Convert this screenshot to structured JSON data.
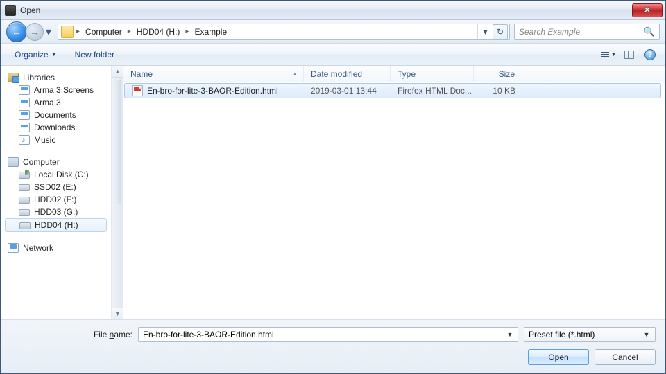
{
  "window": {
    "title": "Open"
  },
  "nav": {
    "breadcrumb": [
      "Computer",
      "HDD04 (H:)",
      "Example"
    ],
    "search_placeholder": "Search Example"
  },
  "toolbar": {
    "organize": "Organize",
    "new_folder": "New folder"
  },
  "tree": {
    "libraries": {
      "label": "Libraries",
      "items": [
        "Arma 3 Screens",
        "Arma 3",
        "Documents",
        "Downloads",
        "Music"
      ]
    },
    "computer": {
      "label": "Computer",
      "items": [
        "Local Disk (C:)",
        "SSD02 (E:)",
        "HDD02 (F:)",
        "HDD03 (G:)",
        "HDD04 (H:)"
      ],
      "selected_index": 4
    },
    "network": {
      "label": "Network"
    }
  },
  "columns": {
    "name": "Name",
    "date": "Date modified",
    "type": "Type",
    "size": "Size"
  },
  "files": [
    {
      "name": "En-bro-for-lite-3-BAOR-Edition.html",
      "date": "2019-03-01 13:44",
      "type": "Firefox HTML Doc...",
      "size": "10 KB",
      "selected": true
    }
  ],
  "footer": {
    "filename_label_pre": "File ",
    "filename_label_hot": "n",
    "filename_label_post": "ame:",
    "filename_value": "En-bro-for-lite-3-BAOR-Edition.html",
    "filter": "Preset file (*.html)",
    "open": "Open",
    "cancel": "Cancel"
  }
}
